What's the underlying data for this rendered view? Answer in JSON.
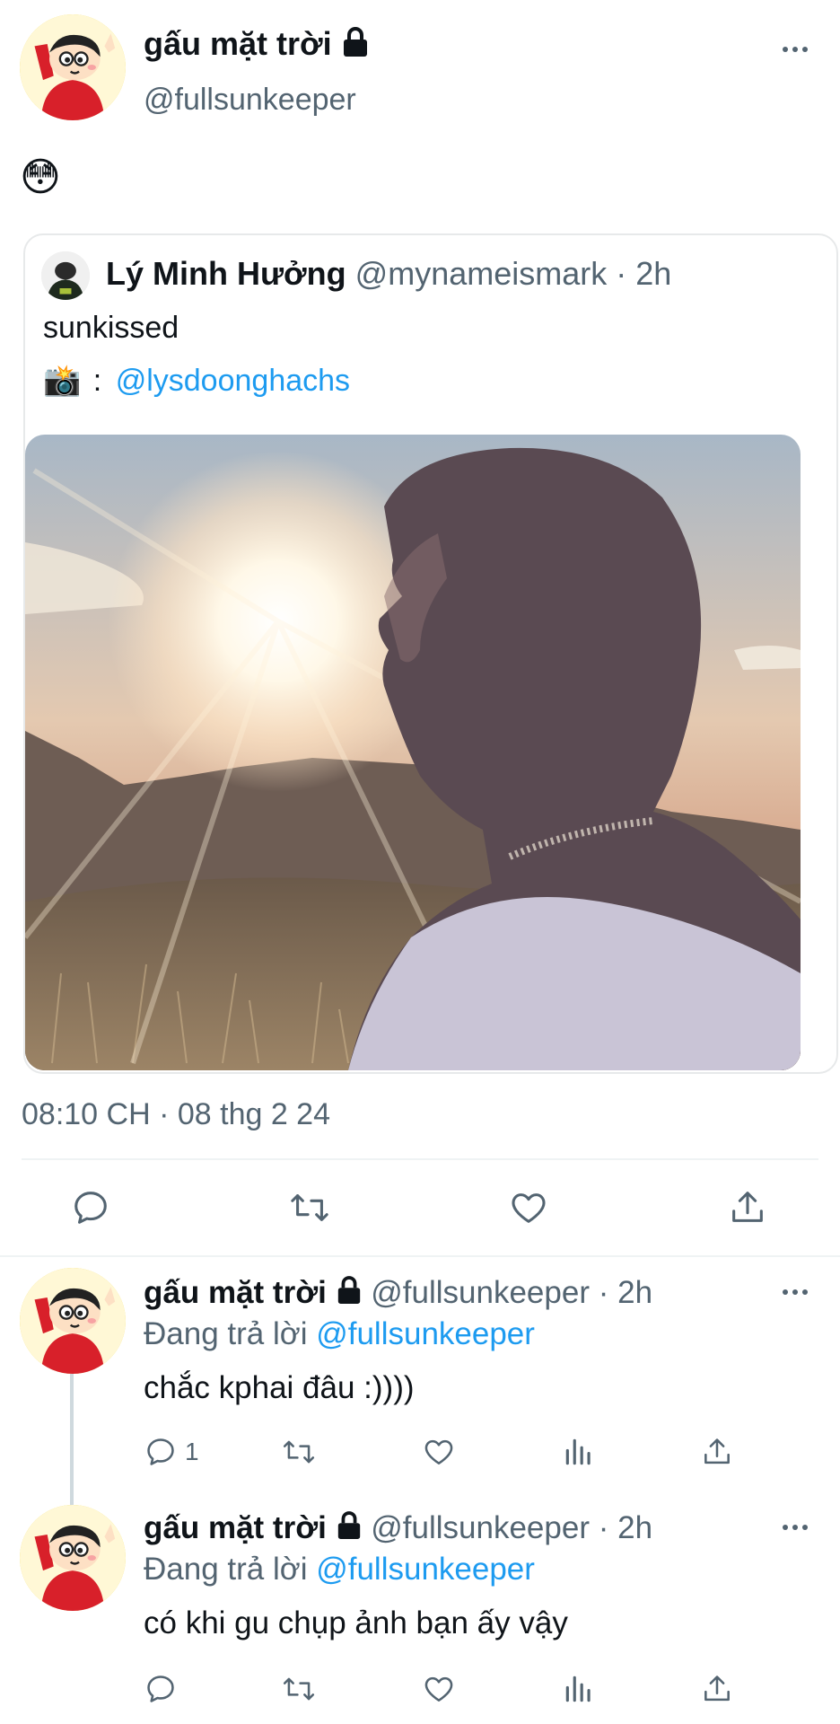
{
  "main_tweet": {
    "display_name": "gấu mặt trời",
    "handle": "@fullsunkeeper",
    "body_emoji": "😳",
    "timestamp": "08:10 CH · 08 thg 2 24"
  },
  "quote": {
    "display_name": "Lý Minh Hưởng",
    "handle": "@mynameismark",
    "dot": "·",
    "time": "2h",
    "text": "sunkissed",
    "credit_emoji": "📸",
    "credit_sep": ":",
    "credit_handle": "@lysdoonghachs"
  },
  "replies": [
    {
      "display_name": "gấu mặt trời",
      "handle": "@fullsunkeeper",
      "dot": "·",
      "time": "2h",
      "replying_prefix": "Đang trả lời",
      "replying_to": "@fullsunkeeper",
      "text": "chắc kphai đâu :))))",
      "reply_count": "1"
    },
    {
      "display_name": "gấu mặt trời",
      "handle": "@fullsunkeeper",
      "dot": "·",
      "time": "2h",
      "replying_prefix": "Đang trả lời",
      "replying_to": "@fullsunkeeper",
      "text": "có khi gu chụp ảnh bạn ấy vậy",
      "reply_count": ""
    }
  ],
  "colors": {
    "accent": "#1d9bf0",
    "muted": "#536471",
    "divider": "#eff3f4"
  },
  "icons": [
    "lock-icon",
    "more-icon",
    "reply-icon",
    "retweet-icon",
    "like-icon",
    "share-icon",
    "views-icon"
  ]
}
